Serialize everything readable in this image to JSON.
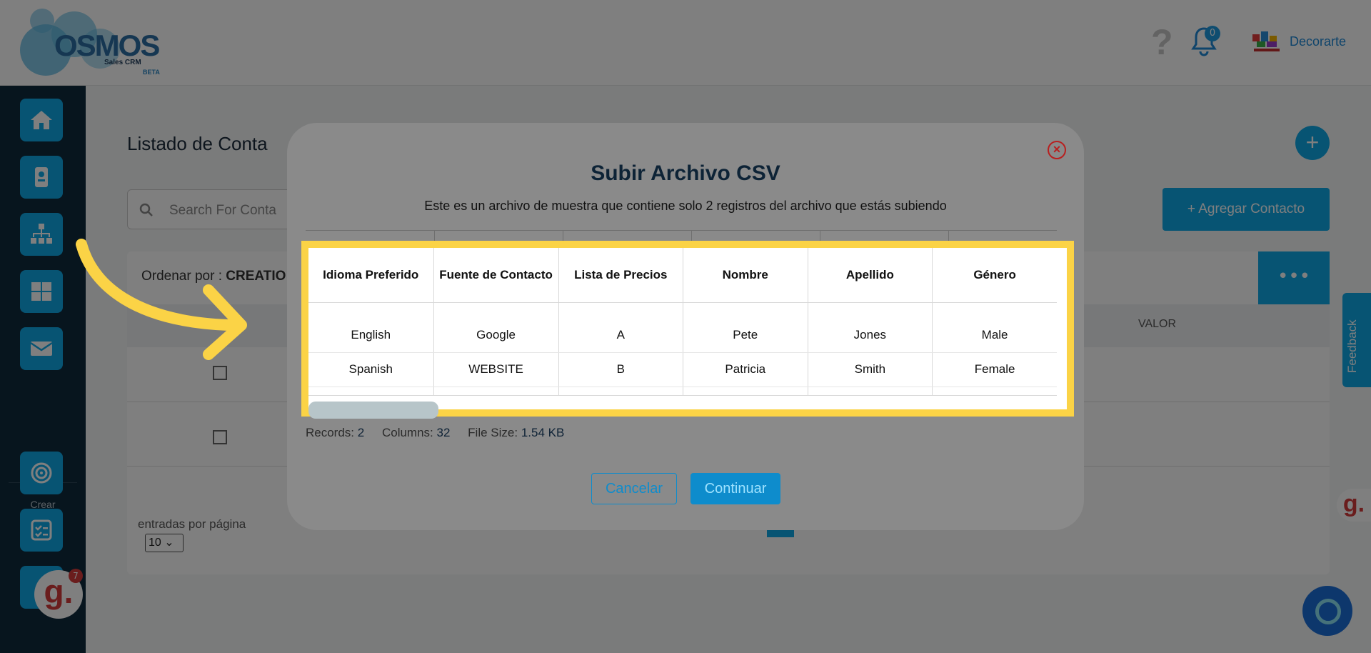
{
  "app": {
    "logo_word": "OSMOS",
    "logo_sub": "Sales CRM",
    "logo_badge": "BETA",
    "help_glyph": "?",
    "notifications_count": "0",
    "org_name": "Decorarte",
    "accent_color": "#0fa8e6"
  },
  "sidebar": {
    "crear_label": "Crear",
    "icons": [
      "home-icon",
      "contact-card-icon",
      "org-chart-icon",
      "grid-icon",
      "mail-icon",
      "target-icon",
      "checklist-icon"
    ]
  },
  "main": {
    "title": "Listado de Conta",
    "search_placeholder": "Search For Conta",
    "add_contact_label": "+ Agregar Contacto",
    "plus_label": "+",
    "order_by_label": "Ordenar por :",
    "order_by_value": "CREATIO",
    "more_label": "•••",
    "valor_header": "VALOR",
    "per_page_label": "entradas por página",
    "per_page_value": "10"
  },
  "widgets": {
    "feedback_label": "Feedback",
    "g_label": "g.",
    "g_badge": "7"
  },
  "modal": {
    "close_glyph": "×",
    "title": "Subir Archivo CSV",
    "description": "Este es un archivo de muestra que contiene solo 2 registros del archivo que estás subiendo",
    "table": {
      "headers": [
        "Idioma Preferido",
        "Fuente de Contacto",
        "Lista de Precios",
        "Nombre",
        "Apellido",
        "Género"
      ],
      "rows": [
        [
          "English",
          "Google",
          "A",
          "Pete",
          "Jones",
          "Male"
        ],
        [
          "Spanish",
          "WEBSITE",
          "B",
          "Patricia",
          "Smith",
          "Female"
        ]
      ]
    },
    "records_label": "Records:",
    "records_value": "2",
    "columns_label": "Columns:",
    "columns_value": "32",
    "filesize_label": "File Size:",
    "filesize_value": "1.54 KB",
    "cancel_label": "Cancelar",
    "continue_label": "Continuar",
    "highlight_color": "#fbd346"
  }
}
